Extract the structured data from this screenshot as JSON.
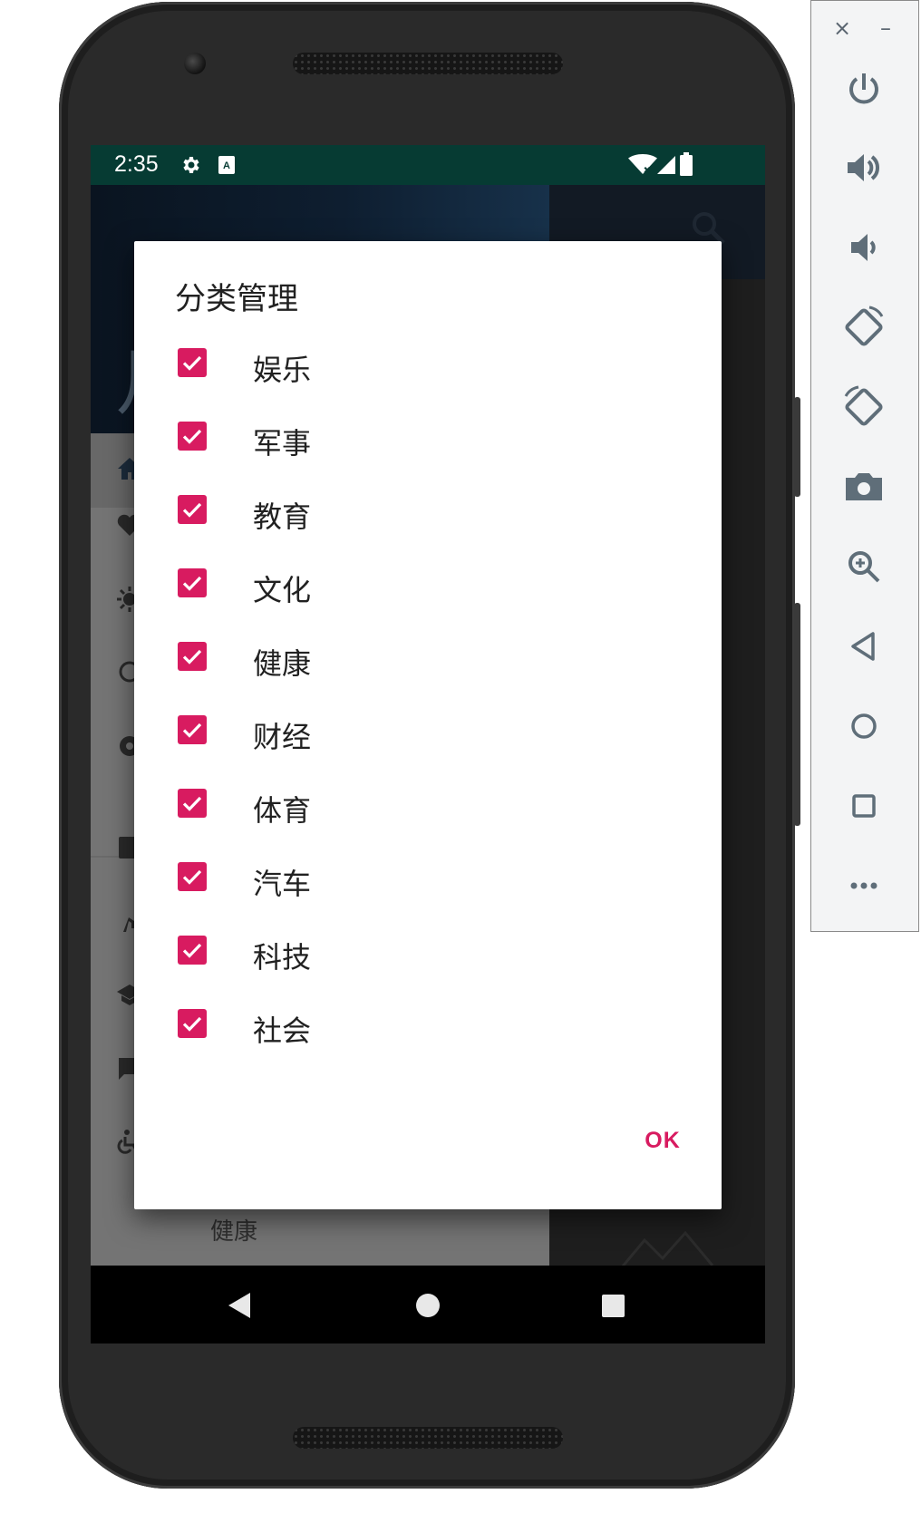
{
  "status_bar": {
    "time": "2:35",
    "icons": [
      "gear-icon",
      "a11y-a-icon",
      "wifi-off-icon",
      "signal-icon",
      "battery-icon"
    ]
  },
  "background_app": {
    "header_glyph": "月",
    "drawer_visible_label": "健康"
  },
  "dialog": {
    "title": "分类管理",
    "options": [
      {
        "label": "娱乐",
        "checked": true
      },
      {
        "label": "军事",
        "checked": true
      },
      {
        "label": "教育",
        "checked": true
      },
      {
        "label": "文化",
        "checked": true
      },
      {
        "label": "健康",
        "checked": true
      },
      {
        "label": "财经",
        "checked": true
      },
      {
        "label": "体育",
        "checked": true
      },
      {
        "label": "汽车",
        "checked": true
      },
      {
        "label": "科技",
        "checked": true
      },
      {
        "label": "社会",
        "checked": true
      }
    ],
    "ok_label": "OK",
    "accent_color": "#d81b60"
  },
  "nav_bar": {
    "buttons": [
      "back-icon",
      "home-icon",
      "recents-icon"
    ]
  },
  "emulator_toolbar": {
    "close_glyph": "×",
    "minimize_glyph": "–",
    "buttons": [
      "power-icon",
      "volume-up-icon",
      "volume-down-icon",
      "rotate-left-icon",
      "rotate-right-icon",
      "camera-icon",
      "zoom-icon",
      "back-icon",
      "home-icon",
      "overview-icon",
      "more-icon"
    ]
  }
}
